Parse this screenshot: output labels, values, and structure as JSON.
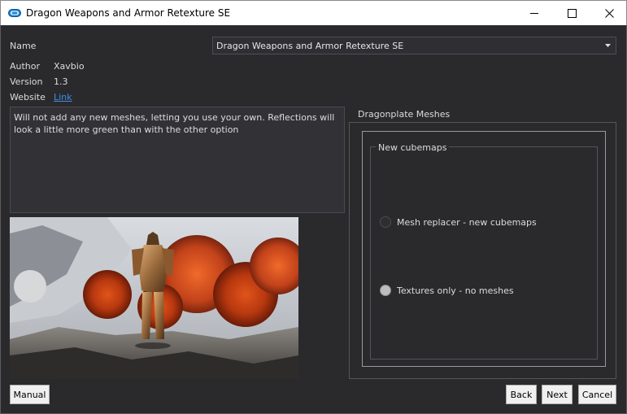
{
  "window": {
    "title": "Dragon Weapons and Armor Retexture SE"
  },
  "info": {
    "name_label": "Name",
    "author_label": "Author",
    "author_value": "Xavbio",
    "version_label": "Version",
    "version_value": "1.3",
    "website_label": "Website",
    "website_link": "Link"
  },
  "name_select": {
    "value": "Dragon Weapons and Armor Retexture SE"
  },
  "description": {
    "text": "Will not add any new meshes, letting you use your own. Reflections will look a little more green than with the other option"
  },
  "options": {
    "group_title": "Dragonplate Meshes",
    "subgroup_title": "New cubemaps",
    "items": [
      {
        "label": "Mesh replacer - new cubemaps",
        "checked": false
      },
      {
        "label": "Textures only - no meshes",
        "checked": true
      }
    ]
  },
  "buttons": {
    "manual": "Manual",
    "back": "Back",
    "next": "Next",
    "cancel": "Cancel"
  }
}
